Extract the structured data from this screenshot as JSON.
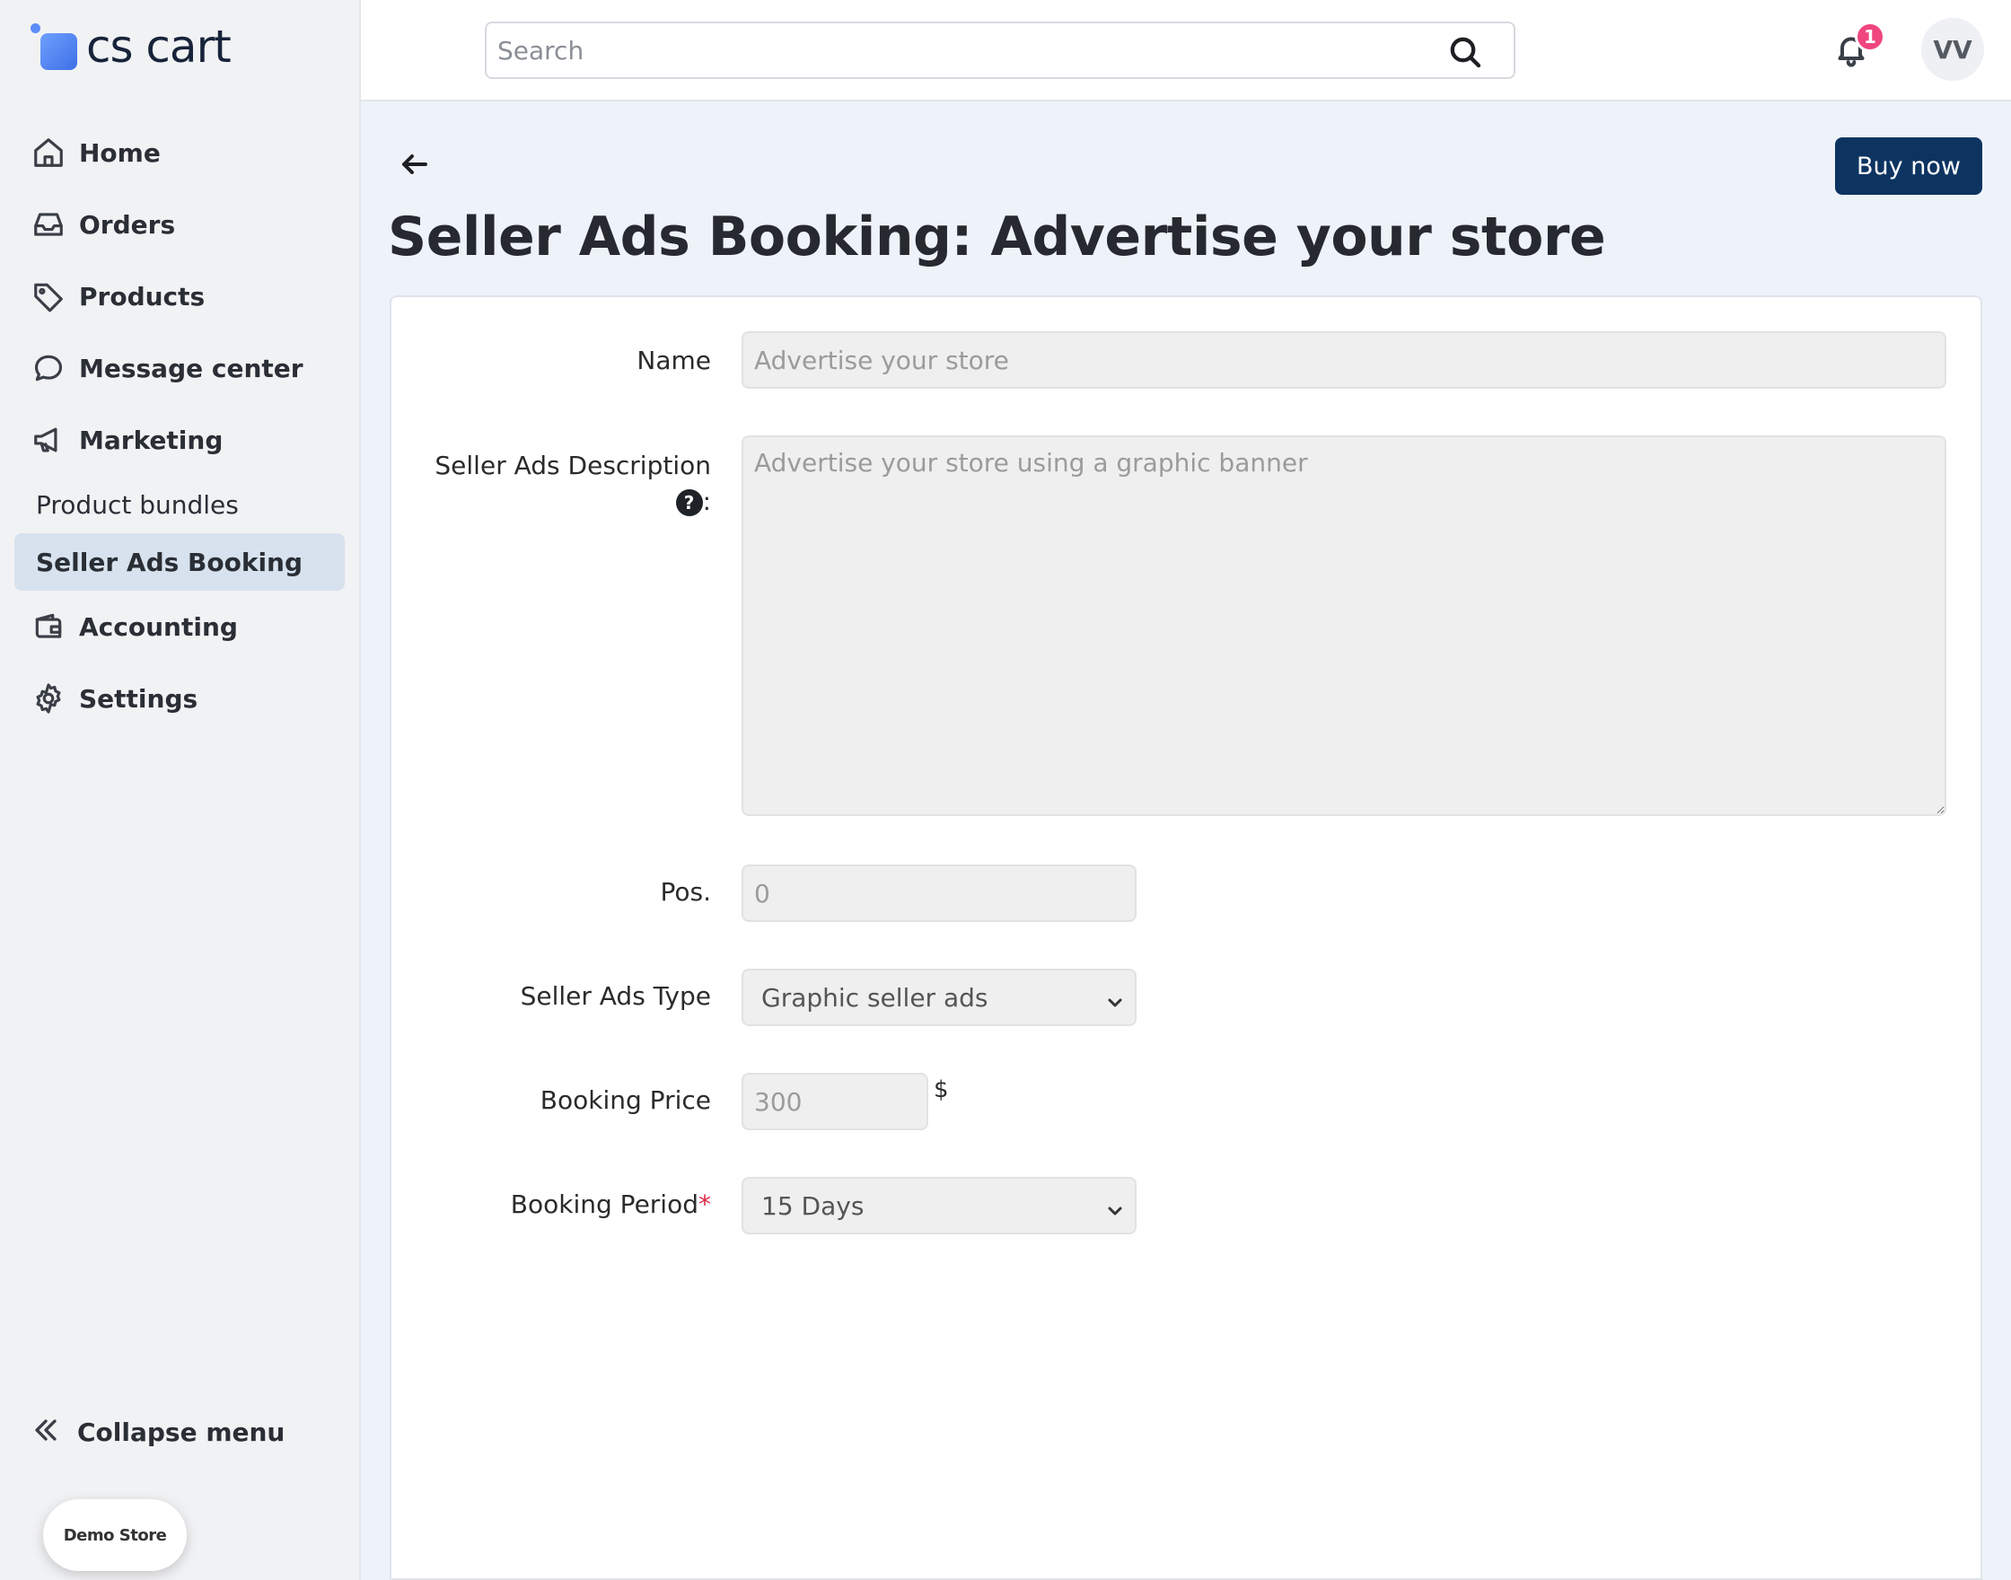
{
  "app": {
    "logo_text": "cs cart"
  },
  "sidebar": {
    "items": [
      {
        "label": "Home",
        "icon": "home-icon"
      },
      {
        "label": "Orders",
        "icon": "inbox-icon"
      },
      {
        "label": "Products",
        "icon": "tag-icon"
      },
      {
        "label": "Message center",
        "icon": "chat-bubble-icon"
      },
      {
        "label": "Marketing",
        "icon": "megaphone-icon"
      }
    ],
    "marketing_sub": [
      {
        "label": "Product bundles",
        "active": false
      },
      {
        "label": "Seller Ads Booking",
        "active": true
      }
    ],
    "items_after": [
      {
        "label": "Accounting",
        "icon": "wallet-icon"
      },
      {
        "label": "Settings",
        "icon": "gear-icon"
      }
    ],
    "collapse_label": "Collapse menu",
    "demo_store_label": "Demo Store"
  },
  "topbar": {
    "search_placeholder": "Search",
    "notification_count": "1",
    "avatar_initials": "VV"
  },
  "page": {
    "title": "Seller Ads Booking: Advertise your store",
    "buy_now_label": "Buy now"
  },
  "form": {
    "name": {
      "label": "Name",
      "value": "Advertise your store"
    },
    "description": {
      "label": "Seller Ads Description",
      "help": "?",
      "colon": ":",
      "value": "Advertise your store using a graphic banner"
    },
    "position": {
      "label": "Pos.",
      "value": "0"
    },
    "ads_type": {
      "label": "Seller Ads Type",
      "value": "Graphic seller ads"
    },
    "booking_price": {
      "label": "Booking Price",
      "value": "300",
      "currency": "$"
    },
    "booking_period": {
      "label": "Booking Period",
      "required_mark": "*",
      "value": "15 Days"
    }
  },
  "colors": {
    "primary_button": "#0d3461",
    "active_nav_bg": "#d7e2ee",
    "badge": "#f0457e",
    "main_bg": "#eef2f9"
  }
}
